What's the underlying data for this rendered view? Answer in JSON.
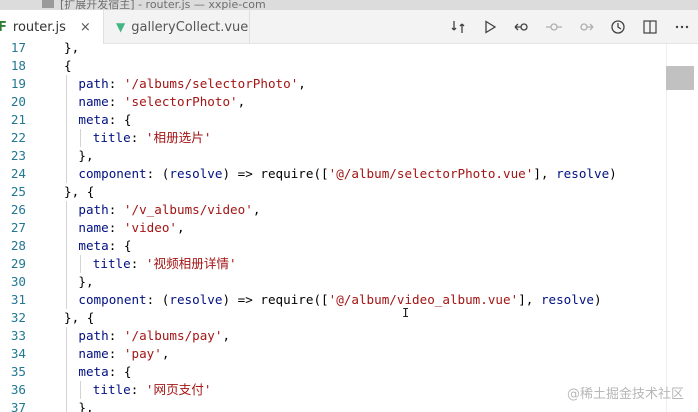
{
  "window": {
    "title": "[扩展开发宿主] - router.js — xxpie-com"
  },
  "tabs": [
    {
      "icon": "F",
      "label": "router.js",
      "close": "×"
    },
    {
      "icon": "▼",
      "label": "galleryCollect.vue"
    }
  ],
  "toolbar_icons": [
    "compare-icon",
    "run-icon",
    "go-back-icon",
    "commit-icon",
    "go-forward-icon",
    "timeline-icon",
    "split-editor-icon",
    "more-icon"
  ],
  "lines": [
    {
      "n": "17",
      "indent": 1,
      "tokens": [
        {
          "t": "}",
          "c": "punc"
        },
        {
          "t": ",",
          "c": "punc"
        }
      ]
    },
    {
      "n": "18",
      "indent": 1,
      "tokens": [
        {
          "t": "{",
          "c": "punc"
        }
      ]
    },
    {
      "n": "19",
      "indent": 2,
      "tokens": [
        {
          "t": "path",
          "c": "key"
        },
        {
          "t": ": ",
          "c": "punc"
        },
        {
          "t": "'/albums/selectorPhoto'",
          "c": "str"
        },
        {
          "t": ",",
          "c": "punc"
        }
      ]
    },
    {
      "n": "20",
      "indent": 2,
      "tokens": [
        {
          "t": "name",
          "c": "key"
        },
        {
          "t": ": ",
          "c": "punc"
        },
        {
          "t": "'selectorPhoto'",
          "c": "str"
        },
        {
          "t": ",",
          "c": "punc"
        }
      ]
    },
    {
      "n": "21",
      "indent": 2,
      "tokens": [
        {
          "t": "meta",
          "c": "key"
        },
        {
          "t": ": {",
          "c": "punc"
        }
      ]
    },
    {
      "n": "22",
      "indent": 3,
      "tokens": [
        {
          "t": "title",
          "c": "key"
        },
        {
          "t": ": ",
          "c": "punc"
        },
        {
          "t": "'相册选片'",
          "c": "str"
        }
      ]
    },
    {
      "n": "23",
      "indent": 2,
      "tokens": [
        {
          "t": "},",
          "c": "punc"
        }
      ]
    },
    {
      "n": "24",
      "indent": 2,
      "tokens": [
        {
          "t": "component",
          "c": "key"
        },
        {
          "t": ": (",
          "c": "punc"
        },
        {
          "t": "resolve",
          "c": "key"
        },
        {
          "t": ") => require([",
          "c": "punc"
        },
        {
          "t": "'@/album/selectorPhoto.vue'",
          "c": "str"
        },
        {
          "t": "], ",
          "c": "punc"
        },
        {
          "t": "resolve",
          "c": "key"
        },
        {
          "t": ")",
          "c": "punc"
        }
      ]
    },
    {
      "n": "25",
      "indent": 1,
      "tokens": [
        {
          "t": "}, {",
          "c": "punc"
        }
      ]
    },
    {
      "n": "26",
      "indent": 2,
      "tokens": [
        {
          "t": "path",
          "c": "key"
        },
        {
          "t": ": ",
          "c": "punc"
        },
        {
          "t": "'/v_albums/video'",
          "c": "str"
        },
        {
          "t": ",",
          "c": "punc"
        }
      ]
    },
    {
      "n": "27",
      "indent": 2,
      "tokens": [
        {
          "t": "name",
          "c": "key"
        },
        {
          "t": ": ",
          "c": "punc"
        },
        {
          "t": "'video'",
          "c": "str"
        },
        {
          "t": ",",
          "c": "punc"
        }
      ]
    },
    {
      "n": "28",
      "indent": 2,
      "tokens": [
        {
          "t": "meta",
          "c": "key"
        },
        {
          "t": ": {",
          "c": "punc"
        }
      ]
    },
    {
      "n": "29",
      "indent": 3,
      "tokens": [
        {
          "t": "title",
          "c": "key"
        },
        {
          "t": ": ",
          "c": "punc"
        },
        {
          "t": "'视频相册详情'",
          "c": "str"
        }
      ]
    },
    {
      "n": "30",
      "indent": 2,
      "tokens": [
        {
          "t": "},",
          "c": "punc"
        }
      ]
    },
    {
      "n": "31",
      "indent": 2,
      "tokens": [
        {
          "t": "component",
          "c": "key"
        },
        {
          "t": ": (",
          "c": "punc"
        },
        {
          "t": "resolve",
          "c": "key"
        },
        {
          "t": ") => require([",
          "c": "punc"
        },
        {
          "t": "'@/album/video_album.vue'",
          "c": "str"
        },
        {
          "t": "], ",
          "c": "punc"
        },
        {
          "t": "resolve",
          "c": "key"
        },
        {
          "t": ")",
          "c": "punc"
        }
      ]
    },
    {
      "n": "32",
      "indent": 1,
      "tokens": [
        {
          "t": "}, {",
          "c": "punc"
        }
      ]
    },
    {
      "n": "33",
      "indent": 2,
      "tokens": [
        {
          "t": "path",
          "c": "key"
        },
        {
          "t": ": ",
          "c": "punc"
        },
        {
          "t": "'/albums/pay'",
          "c": "str"
        },
        {
          "t": ",",
          "c": "punc"
        }
      ]
    },
    {
      "n": "34",
      "indent": 2,
      "tokens": [
        {
          "t": "name",
          "c": "key"
        },
        {
          "t": ": ",
          "c": "punc"
        },
        {
          "t": "'pay'",
          "c": "str"
        },
        {
          "t": ",",
          "c": "punc"
        }
      ]
    },
    {
      "n": "35",
      "indent": 2,
      "tokens": [
        {
          "t": "meta",
          "c": "key"
        },
        {
          "t": ": {",
          "c": "punc"
        }
      ]
    },
    {
      "n": "36",
      "indent": 3,
      "tokens": [
        {
          "t": "title",
          "c": "key"
        },
        {
          "t": ": ",
          "c": "punc"
        },
        {
          "t": "'网页支付'",
          "c": "str"
        }
      ]
    },
    {
      "n": "37",
      "indent": 2,
      "tokens": [
        {
          "t": "},",
          "c": "punc"
        }
      ]
    }
  ],
  "watermark": "@稀土掘金技术社区",
  "colors": {
    "key": "#001080",
    "string": "#a31515",
    "line_number": "#237893",
    "vue_green": "#41b883"
  }
}
